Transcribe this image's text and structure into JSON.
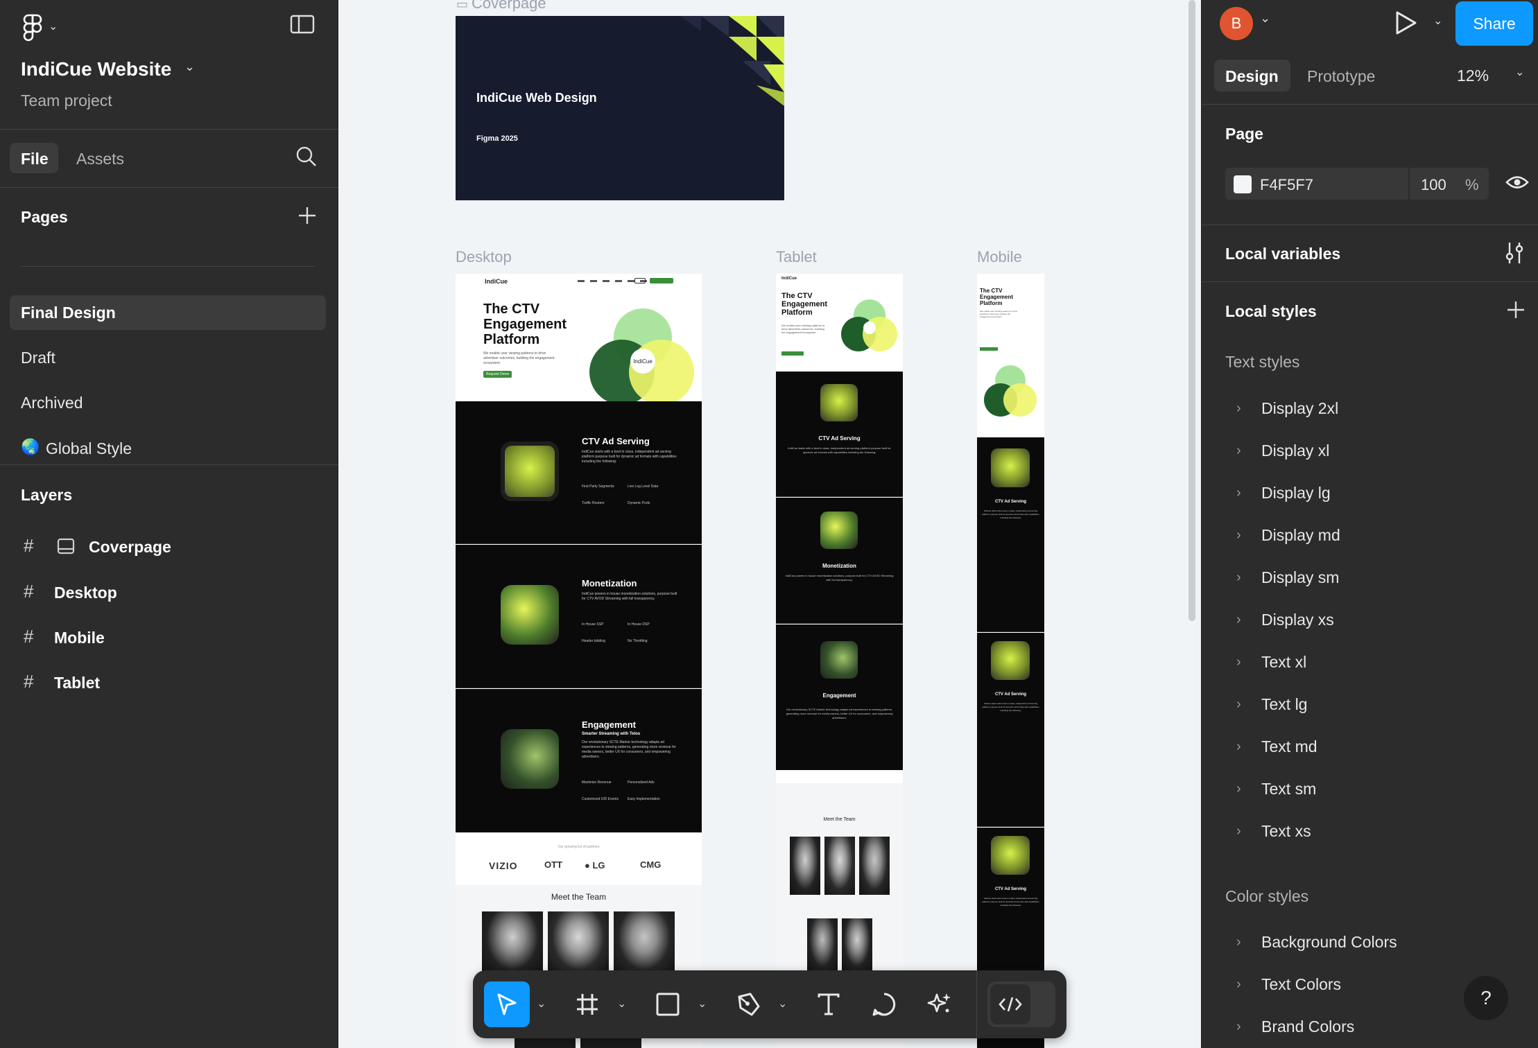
{
  "file": {
    "name": "IndiCue Website",
    "project": "Team project"
  },
  "left_tabs": {
    "file": "File",
    "assets": "Assets"
  },
  "pages": {
    "heading": "Pages",
    "items": [
      {
        "label": "Final Design",
        "selected": true
      },
      {
        "label": "Draft"
      },
      {
        "label": "Archived"
      },
      {
        "label": "Global Style",
        "emoji": "🌏"
      }
    ]
  },
  "layers": {
    "heading": "Layers",
    "items": [
      {
        "label": "Coverpage"
      },
      {
        "label": "Desktop"
      },
      {
        "label": "Mobile"
      },
      {
        "label": "Tablet"
      }
    ]
  },
  "header_right": {
    "avatar_initial": "B",
    "share_label": "Share",
    "tabs": {
      "design": "Design",
      "prototype": "Prototype"
    },
    "zoom": "12%"
  },
  "page_panel": {
    "heading": "Page",
    "color_hex": "F4F5F7",
    "opacity": "100",
    "opacity_unit": "%"
  },
  "local_variables": "Local variables",
  "local_styles": "Local styles",
  "text_styles": {
    "heading": "Text styles",
    "items": [
      "Display 2xl",
      "Display xl",
      "Display lg",
      "Display md",
      "Display sm",
      "Display xs",
      "Text xl",
      "Text lg",
      "Text md",
      "Text sm",
      "Text xs"
    ]
  },
  "color_styles": {
    "heading": "Color styles",
    "items": [
      "Background Colors",
      "Text Colors",
      "Brand Colors"
    ]
  },
  "help": "?",
  "canvas": {
    "labels": {
      "coverpage": "Coverpage",
      "desktop": "Desktop",
      "tablet": "Tablet",
      "mobile": "Mobile"
    },
    "cover": {
      "title": "IndiCue Web Design",
      "subtitle": "Figma 2025"
    },
    "site": {
      "logo": "IndiCue",
      "hero": "The CTV Engagement Platform",
      "hero_body": "We enable user viewing patterns to drive advertiser outcomes, building the engagement ecosystem.",
      "cta": "Request Demo",
      "venn_center": "IndiCue",
      "sections": [
        {
          "title": "CTV Ad Serving",
          "body": "IndiCue starts with a best in class, independent ad serving platform purpose built for dynamic ad formats with capabilities including the following:",
          "f1": "First Party Segments",
          "f2": "Live Log Level Data",
          "f3": "Traffic Routers",
          "f4": "Dynamic Pods"
        },
        {
          "title": "Monetization",
          "body": "IndiCue powers in house monetization solutions, purpose built for CTV AVOD Streaming with full transparency.",
          "f1": "In House SSP",
          "f2": "In House DSP",
          "f3": "Header bidding",
          "f4": "No Throttling"
        },
        {
          "title": "Engagement",
          "sub": "Smarter Streaming with Telos",
          "body": "Our revolutionary SCTE Marker technology adapts ad experiences to viewing patterns, generating more revenue for media owners, better UX for consumers, and empowering advertisers.",
          "f1": "Maximize Revenue",
          "f2": "Personalized Ads",
          "f3": "Customized UID Events",
          "f4": "Easy Implementation"
        }
      ],
      "partners_note": "Our growing list of partners",
      "partners": [
        "VIZIO",
        "OTT",
        "LG",
        "CMG"
      ],
      "team_heading": "Meet the Team"
    }
  },
  "colors": {
    "panel": "#2c2c2c",
    "canvas": "#f1f4f7",
    "accent": "#0d99ff",
    "share": "#0d99ff",
    "avatar": "#e0552f",
    "lime": "#d6f24a",
    "green_dark": "#1f5e2a",
    "navy": "#161b2e"
  }
}
